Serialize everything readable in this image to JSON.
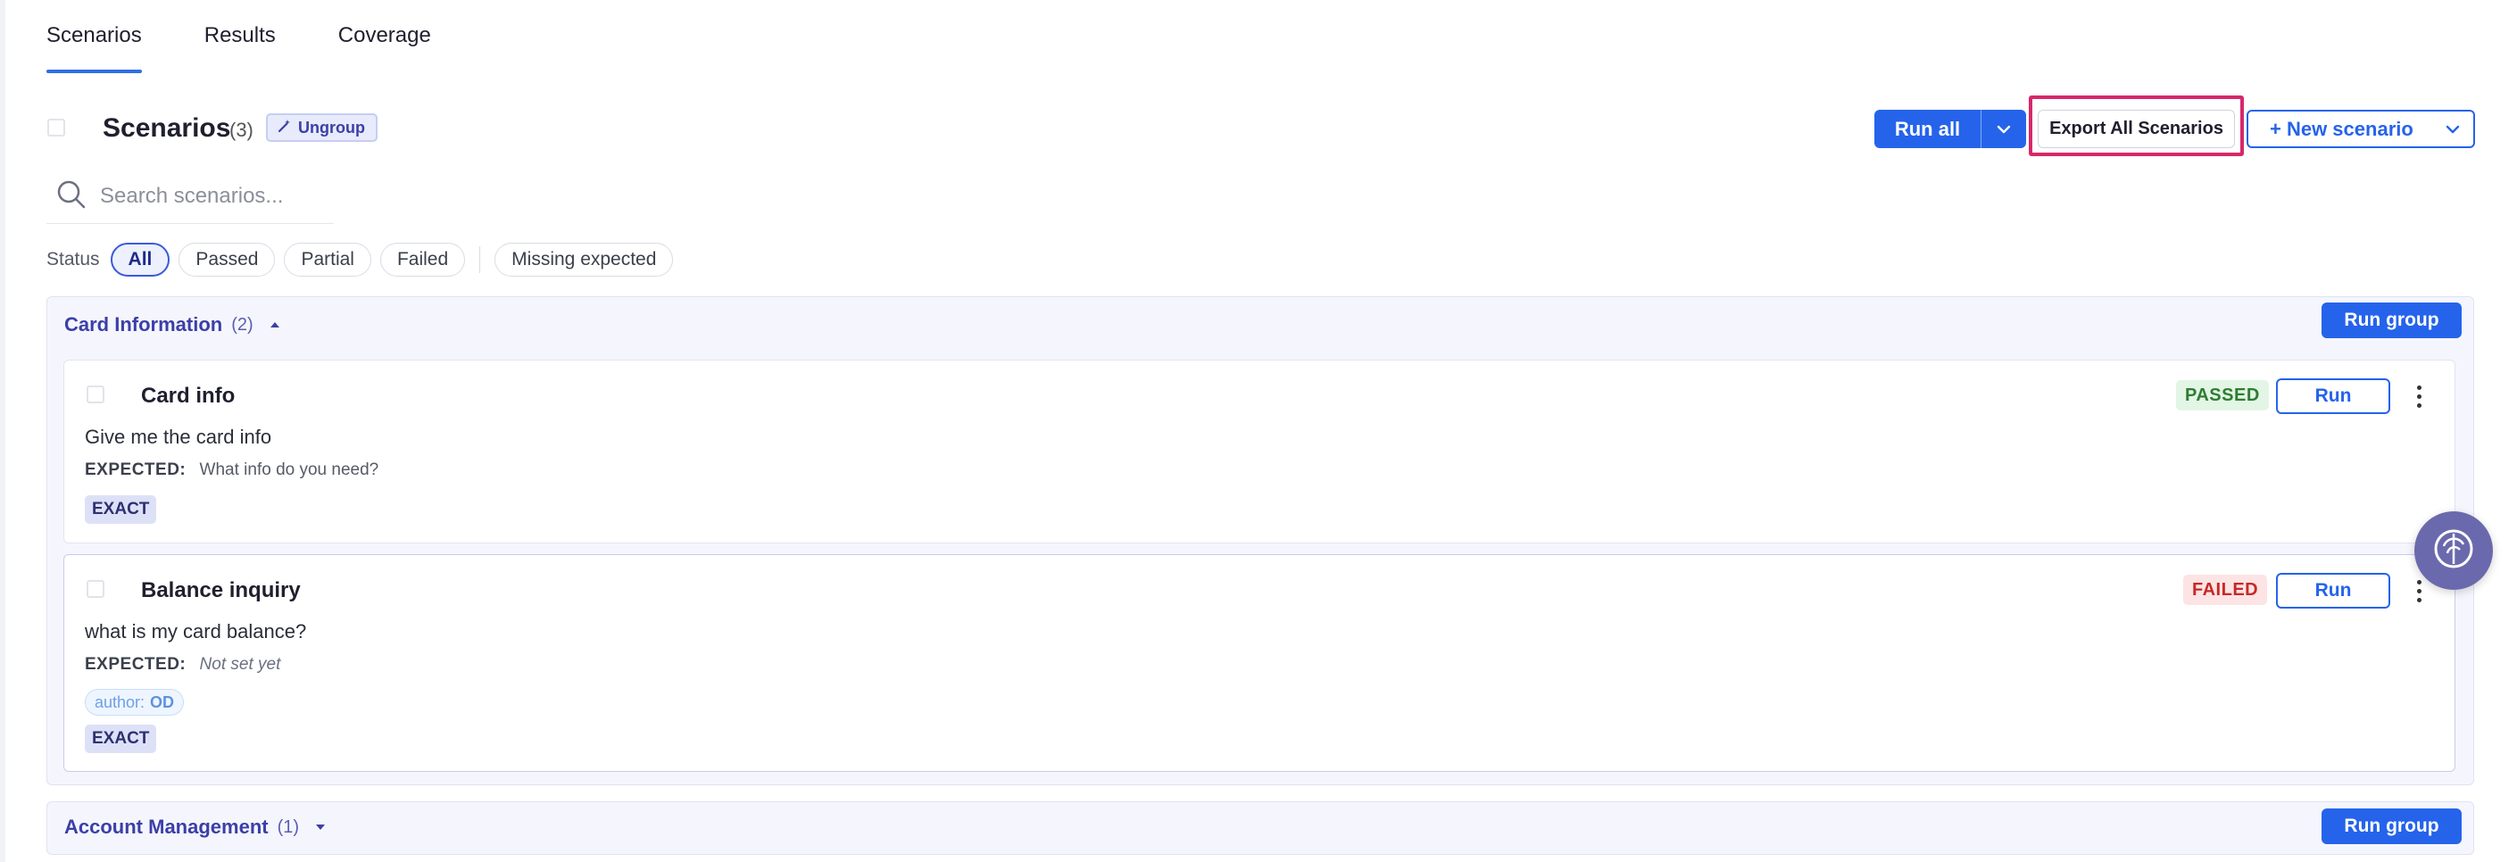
{
  "tabs": [
    {
      "label": "Scenarios",
      "active": true
    },
    {
      "label": "Results",
      "active": false
    },
    {
      "label": "Coverage",
      "active": false
    }
  ],
  "header": {
    "title": "Scenarios",
    "count": "(3)",
    "ungroup_label": "Ungroup",
    "run_all_label": "Run all",
    "export_label": "Export All Scenarios",
    "new_scenario_label": "+ New scenario"
  },
  "search": {
    "placeholder": "Search scenarios..."
  },
  "filters": {
    "label": "Status",
    "chips": [
      "All",
      "Passed",
      "Partial",
      "Failed"
    ],
    "active": "All",
    "extra": "Missing expected"
  },
  "groups": [
    {
      "name": "Card Information",
      "count": "(2)",
      "expanded": true,
      "run_label": "Run group",
      "scenarios": [
        {
          "title": "Card info",
          "prompt": "Give me the card info",
          "expected_key": "EXPECTED:",
          "expected_value": "What info do you need?",
          "status": "PASSED",
          "run_label": "Run",
          "tag": "EXACT"
        },
        {
          "title": "Balance inquiry",
          "prompt": "what is my card balance?",
          "expected_key": "EXPECTED:",
          "expected_value": "Not set yet",
          "status": "FAILED",
          "run_label": "Run",
          "author_key": "author:",
          "author_value": "OD",
          "tag": "EXACT"
        }
      ]
    },
    {
      "name": "Account Management",
      "count": "(1)",
      "expanded": false,
      "run_label": "Run group"
    }
  ],
  "colors": {
    "primary": "#2563eb",
    "highlight": "#d6286a",
    "group_title": "#3b3fa8",
    "passed": "#2e7d32",
    "failed": "#c62828",
    "assistant": "#6b69ad"
  }
}
